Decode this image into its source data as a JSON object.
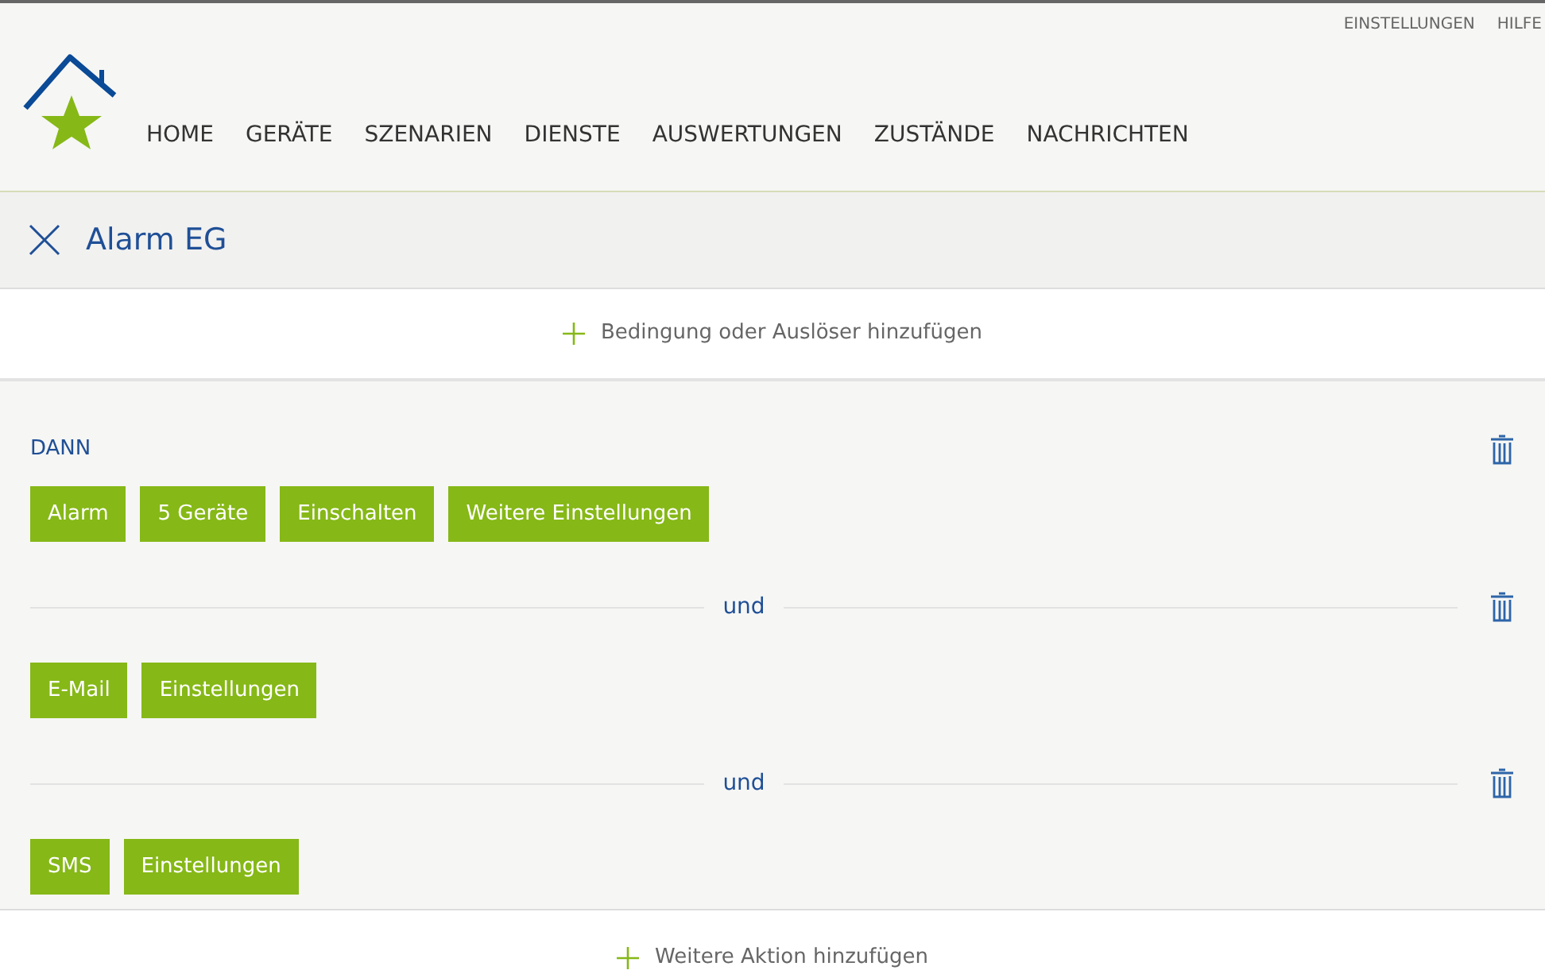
{
  "top_links": [
    "EINSTELLUNGEN",
    "HILFE"
  ],
  "nav": [
    {
      "label": "HOME",
      "selected": false
    },
    {
      "label": "GERÄTE",
      "selected": false
    },
    {
      "label": "SZENARIEN",
      "selected": false
    },
    {
      "label": "DIENSTE",
      "selected": false
    },
    {
      "label": "AUSWERTUNGEN",
      "selected": false
    },
    {
      "label": "ZUSTÄNDE",
      "selected": false
    },
    {
      "label": "NACHRICHTEN",
      "selected": false
    }
  ],
  "title": "Alarm EG",
  "add_condition": "Bedingung oder Auslöser hinzufügen",
  "actions": [
    {
      "kind": "heading",
      "label": "DANN",
      "chips": [
        "Alarm",
        "5 Geräte",
        "Einschalten",
        "Weitere Einstellungen"
      ]
    },
    {
      "kind": "divider",
      "label": "und",
      "chips": [
        "E-Mail",
        "Einstellungen"
      ]
    },
    {
      "kind": "divider",
      "label": "und",
      "chips": [
        "SMS",
        "Einstellungen"
      ]
    }
  ],
  "add_action": "Weitere Aktion hinzufügen"
}
